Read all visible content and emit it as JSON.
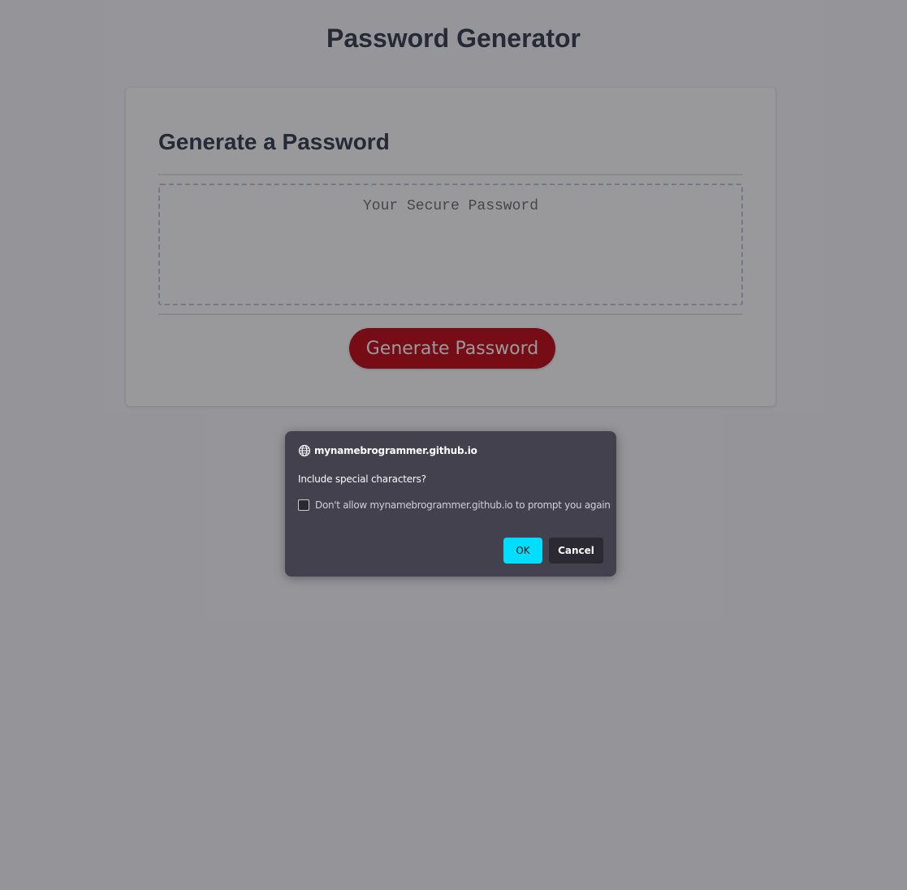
{
  "page": {
    "title": "Password Generator"
  },
  "card": {
    "header": "Generate a Password",
    "password_placeholder": "Your Secure Password",
    "password_value": "",
    "generate_button_label": "Generate Password"
  },
  "dialog": {
    "origin": "mynamebrogrammer.github.io",
    "message": "Include special characters?",
    "checkbox_label": "Don't allow mynamebrogrammer.github.io to prompt you again",
    "checkbox_checked": false,
    "ok_label": "OK",
    "cancel_label": "Cancel",
    "icon": "globe-icon"
  },
  "colors": {
    "accent_button": "#c0000e",
    "ok_button": "#00ddff",
    "dialog_bg": "#42414d"
  }
}
